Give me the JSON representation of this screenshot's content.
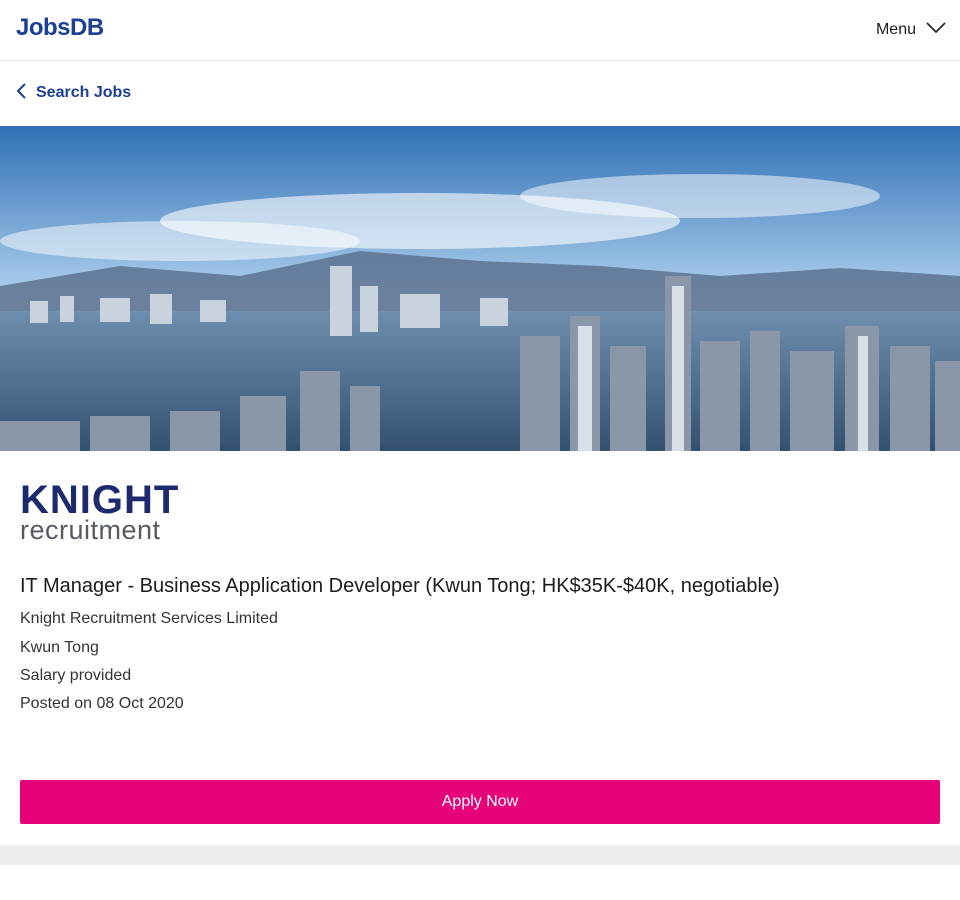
{
  "header": {
    "brand": "JobsDB",
    "menu_label": "Menu"
  },
  "nav": {
    "back_label": "Search Jobs"
  },
  "company_logo": {
    "line1": "KNIGHT",
    "line2": "recruitment"
  },
  "job": {
    "title": "IT Manager - Business Application Developer (Kwun Tong; HK$35K-$40K, negotiable)",
    "company": "Knight Recruitment Services Limited",
    "location": "Kwun Tong",
    "salary": "Salary provided",
    "posted": "Posted on 08 Oct 2020"
  },
  "actions": {
    "apply_label": "Apply Now"
  },
  "colors": {
    "brand": "#1c3f94",
    "apply": "#e60278"
  }
}
